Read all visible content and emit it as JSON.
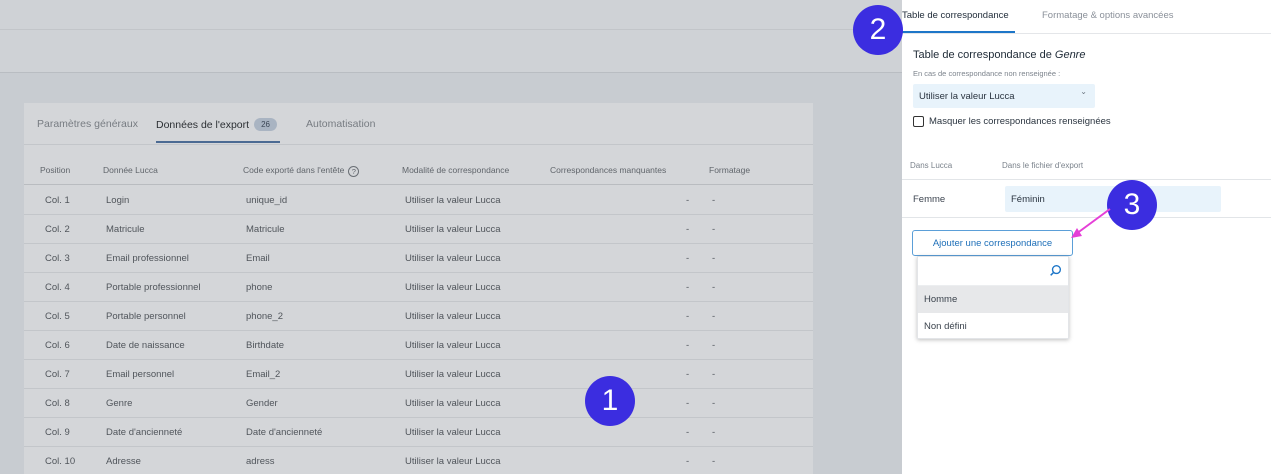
{
  "export_tabs": [
    {
      "label": "Paramètres généraux"
    },
    {
      "label": "Données de l'export",
      "badge": "26"
    },
    {
      "label": "Automatisation"
    }
  ],
  "table": {
    "headers": [
      "Position",
      "Donnée Lucca",
      "Code exporté dans l'entête",
      "Modalité de correspondance",
      "Correspondances manquantes",
      "Formatage"
    ],
    "help_icon": "?",
    "rows": [
      {
        "position": "Col. 1",
        "donnee": "Login",
        "code": "unique_id",
        "modalite": "Utiliser la valeur Lucca",
        "manquantes": "-",
        "formatage": "-"
      },
      {
        "position": "Col. 2",
        "donnee": "Matricule",
        "code": "Matricule",
        "modalite": "Utiliser la valeur Lucca",
        "manquantes": "-",
        "formatage": "-"
      },
      {
        "position": "Col. 3",
        "donnee": "Email professionnel",
        "code": "Email",
        "modalite": "Utiliser la valeur Lucca",
        "manquantes": "-",
        "formatage": "-"
      },
      {
        "position": "Col. 4",
        "donnee": "Portable professionnel",
        "code": "phone",
        "modalite": "Utiliser la valeur Lucca",
        "manquantes": "-",
        "formatage": "-"
      },
      {
        "position": "Col. 5",
        "donnee": "Portable personnel",
        "code": "phone_2",
        "modalite": "Utiliser la valeur Lucca",
        "manquantes": "-",
        "formatage": "-"
      },
      {
        "position": "Col. 6",
        "donnee": "Date de naissance",
        "code": "Birthdate",
        "modalite": "Utiliser la valeur Lucca",
        "manquantes": "-",
        "formatage": "-"
      },
      {
        "position": "Col. 7",
        "donnee": "Email personnel",
        "code": "Email_2",
        "modalite": "Utiliser la valeur Lucca",
        "manquantes": "-",
        "formatage": "-"
      },
      {
        "position": "Col. 8",
        "donnee": "Genre",
        "code": "Gender",
        "modalite": "Utiliser la valeur Lucca",
        "manquantes": "-",
        "formatage": "-"
      },
      {
        "position": "Col. 9",
        "donnee": "Date d'ancienneté",
        "code": "Date d'ancienneté",
        "modalite": "Utiliser la valeur Lucca",
        "manquantes": "-",
        "formatage": "-"
      },
      {
        "position": "Col. 10",
        "donnee": "Adresse",
        "code": "adress",
        "modalite": "Utiliser la valeur Lucca",
        "manquantes": "-",
        "formatage": "-"
      }
    ]
  },
  "panel": {
    "tabs": [
      "Table de correspondance",
      "Formatage & options avancées"
    ],
    "title_prefix": "Table de correspondance de ",
    "title_field": "Genre",
    "fallback_label": "En cas de correspondance non renseignée :",
    "fallback_value": "Utiliser la valeur Lucca",
    "hide_checkbox_label": "Masquer les correspondances renseignées",
    "mapping_headers": [
      "Dans Lucca",
      "Dans le fichier d'export"
    ],
    "mappings": [
      {
        "lucca": "Femme",
        "export": "Féminin"
      }
    ],
    "add_button": "Ajouter une correspondance",
    "dropdown_options": [
      "Homme",
      "Non défini"
    ]
  },
  "markers": [
    "1",
    "2",
    "3"
  ],
  "colors": {
    "marker": "#3b2de0",
    "arrow": "#e53fd7",
    "accent": "#1d76c8"
  }
}
